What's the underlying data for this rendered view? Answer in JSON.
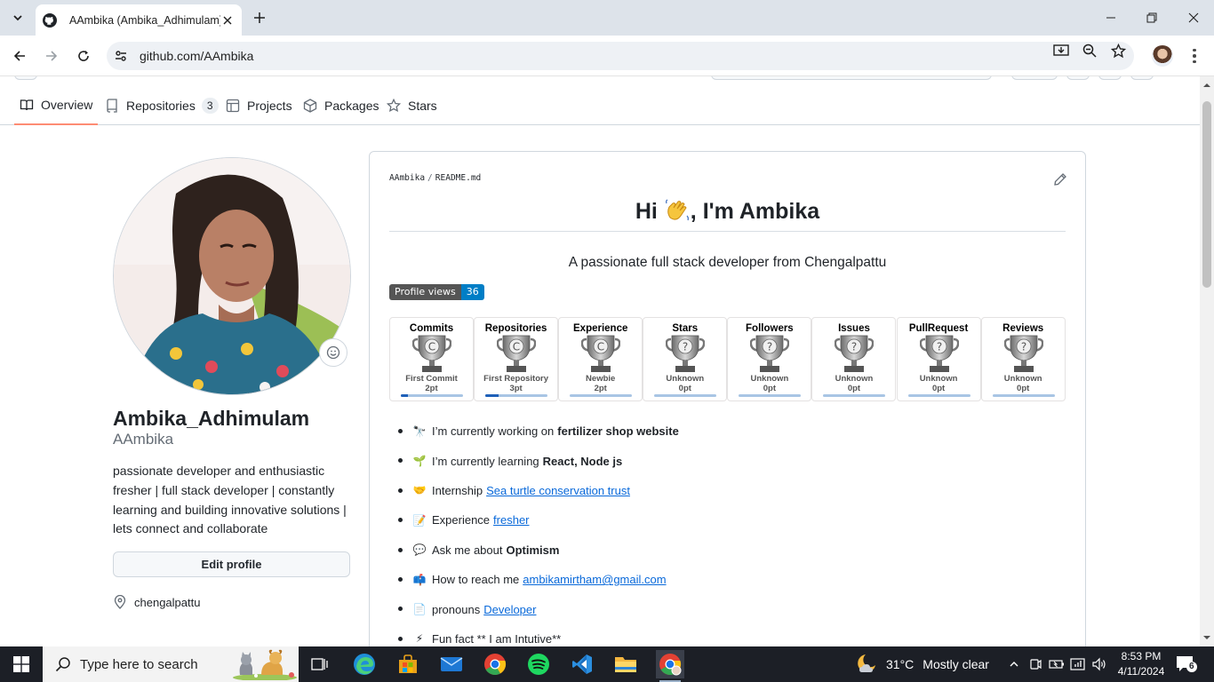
{
  "browser": {
    "tab_title": "AAmbika (Ambika_Adhimulam)",
    "url_host": "github.com",
    "url_path": "/AAmbika"
  },
  "subnav": {
    "items": [
      {
        "label": "Overview",
        "active": true
      },
      {
        "label": "Repositories",
        "count": "3"
      },
      {
        "label": "Projects"
      },
      {
        "label": "Packages"
      },
      {
        "label": "Stars"
      }
    ]
  },
  "profile": {
    "full_name": "Ambika_Adhimulam",
    "username": "AAmbika",
    "bio": "passionate developer and enthusiastic fresher | full stack developer | constantly learning and building innovative solutions | lets connect and collaborate",
    "edit_button": "Edit profile",
    "location": "chengalpattu"
  },
  "readme": {
    "owner": "AAmbika",
    "file": "README.md",
    "heading_pre": "Hi ",
    "heading_post": ", I'm Ambika",
    "tagline": "A passionate full stack developer from Chengalpattu",
    "badge_label": "Profile views",
    "badge_value": "36",
    "trophies": [
      {
        "title": "Commits",
        "rank": "First Commit",
        "points": "2pt",
        "rank_letter": "C",
        "progress": 0.12
      },
      {
        "title": "Repositories",
        "rank": "First Repository",
        "points": "3pt",
        "rank_letter": "C",
        "progress": 0.22
      },
      {
        "title": "Experience",
        "rank": "Newbie",
        "points": "2pt",
        "rank_letter": "C",
        "progress": 0.0
      },
      {
        "title": "Stars",
        "rank": "Unknown",
        "points": "0pt",
        "rank_letter": "?",
        "progress": 0.0
      },
      {
        "title": "Followers",
        "rank": "Unknown",
        "points": "0pt",
        "rank_letter": "?",
        "progress": 0.0
      },
      {
        "title": "Issues",
        "rank": "Unknown",
        "points": "0pt",
        "rank_letter": "?",
        "progress": 0.0
      },
      {
        "title": "PullRequest",
        "rank": "Unknown",
        "points": "0pt",
        "rank_letter": "?",
        "progress": 0.0
      },
      {
        "title": "Reviews",
        "rank": "Unknown",
        "points": "0pt",
        "rank_letter": "?",
        "progress": 0.0
      }
    ],
    "items": [
      {
        "icon": "telescope-icon",
        "text": "I’m currently working on",
        "bold": "fertilizer shop website"
      },
      {
        "icon": "seedling-icon",
        "text": "I’m currently learning",
        "bold": "React, Node js"
      },
      {
        "icon": "handshake-icon",
        "text": "Internship",
        "link": "Sea turtle conservation trust"
      },
      {
        "icon": "memo-icon",
        "text": "Experience",
        "link": "fresher"
      },
      {
        "icon": "speech-bubble-icon",
        "text": "Ask me about",
        "bold": "Optimism"
      },
      {
        "icon": "mailbox-icon",
        "text": "How to reach me",
        "link": "ambikamirtham@gmail.com"
      },
      {
        "icon": "page-icon",
        "text": "pronouns",
        "link": "Developer"
      },
      {
        "icon": "lightning-icon",
        "text": "Fun fact ** I am Intutive**"
      }
    ]
  },
  "taskbar": {
    "search_placeholder": "Type here to search",
    "temperature": "31°C",
    "condition": "Mostly clear",
    "time": "8:53 PM",
    "date": "4/11/2024",
    "notification_count": "6"
  }
}
